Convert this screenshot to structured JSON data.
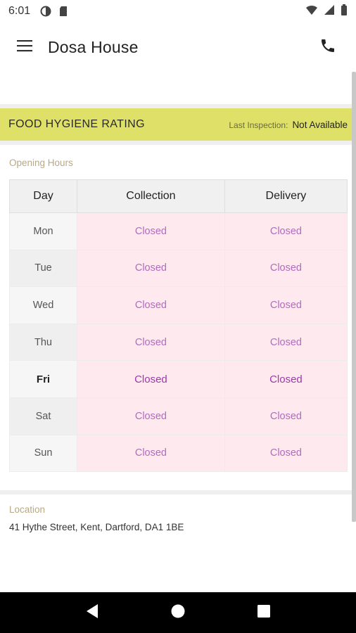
{
  "status_bar": {
    "time": "6:01",
    "left_icons": [
      "data-saver-icon",
      "sd-card-icon"
    ],
    "right_icons": [
      "wifi-icon",
      "signal-icon",
      "battery-icon"
    ]
  },
  "app_bar": {
    "title": "Dosa House",
    "menu_icon": "hamburger-menu-icon",
    "phone_icon": "phone-icon"
  },
  "hygiene": {
    "title": "FOOD HYGIENE RATING",
    "last_inspection_label": "Last Inspection:",
    "last_inspection_value": "Not Available",
    "band_color": "#dfe068"
  },
  "opening_hours": {
    "label": "Opening Hours",
    "headers": [
      "Day",
      "Collection",
      "Delivery"
    ],
    "rows": [
      {
        "day": "Mon",
        "collection": "Closed",
        "delivery": "Closed"
      },
      {
        "day": "Tue",
        "collection": "Closed",
        "delivery": "Closed"
      },
      {
        "day": "Wed",
        "collection": "Closed",
        "delivery": "Closed"
      },
      {
        "day": "Thu",
        "collection": "Closed",
        "delivery": "Closed"
      },
      {
        "day": "Fri",
        "collection": "Closed",
        "delivery": "Closed"
      },
      {
        "day": "Sat",
        "collection": "Closed",
        "delivery": "Closed"
      },
      {
        "day": "Sun",
        "collection": "Closed",
        "delivery": "Closed"
      }
    ],
    "highlighted_day": "Fri",
    "closed_color": "#b36bc1",
    "closed_bg": "#fde9ee"
  },
  "location": {
    "label": "Location",
    "address": "41 Hythe Street, Kent, Dartford, DA1 1BE"
  },
  "nav_bar": {
    "buttons": [
      "back-icon",
      "home-icon",
      "recents-icon"
    ]
  }
}
